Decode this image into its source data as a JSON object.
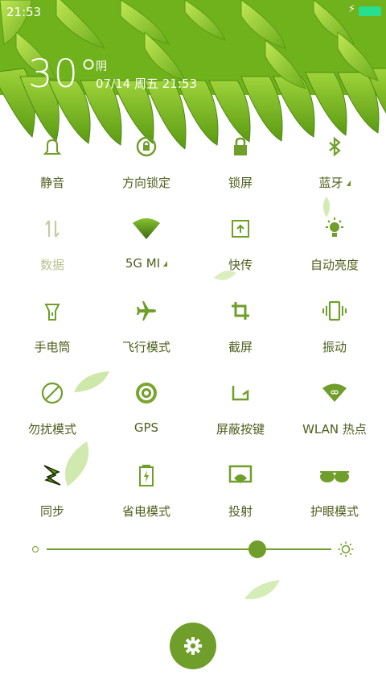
{
  "status_bar": {
    "time": "21:53",
    "charging_icon": "bolt-icon",
    "battery_color": "#27e08f"
  },
  "weather": {
    "temperature": "30°",
    "condition": "阴",
    "datetime": "07/14 周五 21:53"
  },
  "accent_color": "#6f9e2a",
  "toggles": [
    {
      "label": "静音",
      "icon": "bell-icon"
    },
    {
      "label": "方向锁定",
      "icon": "rotation-lock-icon"
    },
    {
      "label": "锁屏",
      "icon": "lock-icon"
    },
    {
      "label": "蓝牙",
      "icon": "bluetooth-icon"
    },
    {
      "label": "数据",
      "icon": "data-arrows-icon"
    },
    {
      "label": "5G   MI",
      "icon": "wifi-icon"
    },
    {
      "label": "快传",
      "icon": "quick-transfer-icon"
    },
    {
      "label": "自动亮度",
      "icon": "auto-brightness-icon"
    },
    {
      "label": "手电筒",
      "icon": "flashlight-icon"
    },
    {
      "label": "飞行模式",
      "icon": "airplane-icon"
    },
    {
      "label": "截屏",
      "icon": "crop-icon"
    },
    {
      "label": "振动",
      "icon": "vibrate-icon"
    },
    {
      "label": "勿扰模式",
      "icon": "do-not-disturb-icon"
    },
    {
      "label": "GPS",
      "icon": "gps-icon"
    },
    {
      "label": "屏蔽按键",
      "icon": "block-keys-icon"
    },
    {
      "label": "WLAN 热点",
      "icon": "hotspot-icon"
    },
    {
      "label": "同步",
      "icon": "sync-icon"
    },
    {
      "label": "省电模式",
      "icon": "battery-saver-icon"
    },
    {
      "label": "投射",
      "icon": "cast-icon"
    },
    {
      "label": "护眼模式",
      "icon": "eye-care-icon"
    }
  ],
  "brightness": {
    "level": 0.74
  },
  "settings_button": {
    "icon": "gear-icon"
  }
}
